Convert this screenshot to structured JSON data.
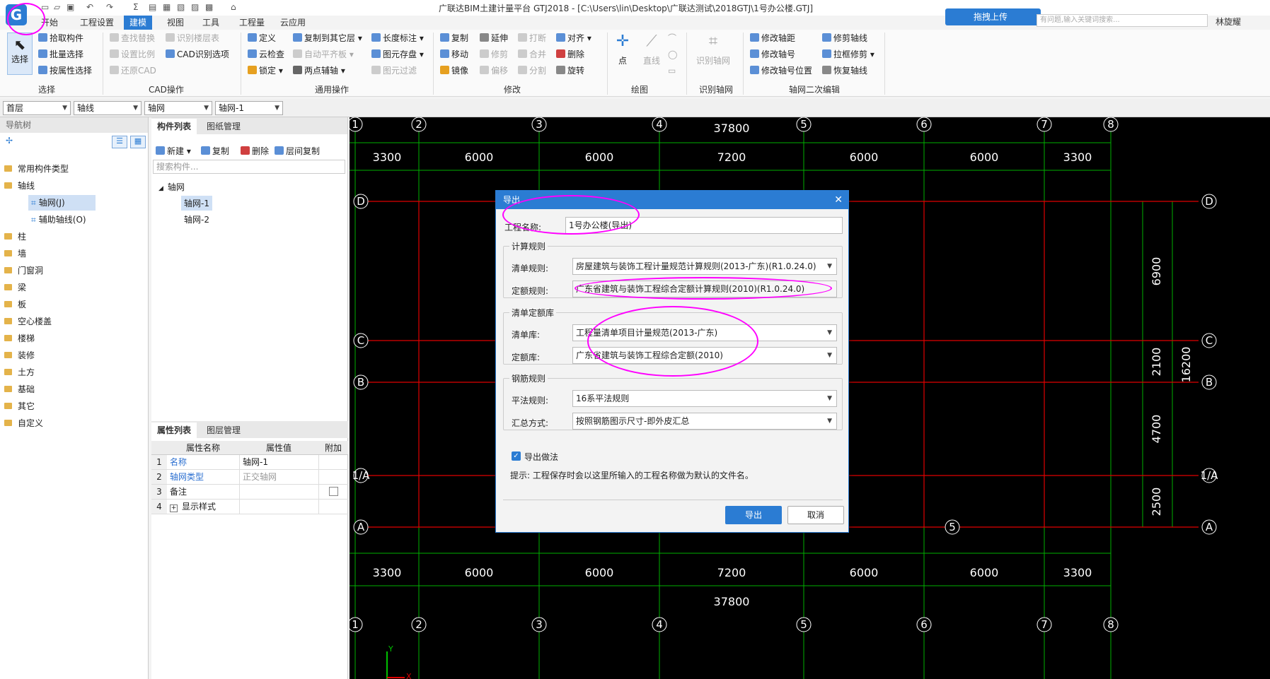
{
  "window": {
    "title": "广联达BIM土建计量平台 GTJ2018 - [C:\\Users\\lin\\Desktop\\广联达测试\\2018GTJ\\1号办公楼.GTJ]",
    "upload_label": "拖拽上传",
    "search_placeholder": "有问题,输入关键词搜索...",
    "user": "林旋耀"
  },
  "menu": [
    "开始",
    "工程设置",
    "建模",
    "视图",
    "工具",
    "工程量",
    "云应用"
  ],
  "ribbon": {
    "select_big": "选择",
    "select_items": [
      "拾取构件",
      "批量选择",
      "按属性选择"
    ],
    "cad_items": [
      "查找替换",
      "设置比例",
      "还原CAD",
      "识别楼层表",
      "CAD识别选项"
    ],
    "common_items": [
      "定义",
      "云检查",
      "锁定",
      "复制到其它层",
      "自动平齐板",
      "两点辅轴",
      "长度标注",
      "图元存盘",
      "图元过滤"
    ],
    "modify_items": [
      "复制",
      "移动",
      "镜像",
      "延伸",
      "修剪",
      "偏移",
      "打断",
      "合并",
      "分割",
      "对齐",
      "删除",
      "旋转"
    ],
    "draw_items": [
      "点",
      "直线"
    ],
    "recognize_axis": "识别轴网",
    "axis_edit_items": [
      "修改轴距",
      "修改轴号",
      "修改轴号位置",
      "修剪轴线",
      "拉框修剪",
      "恢复轴线"
    ],
    "groups": [
      "选择",
      "CAD操作",
      "通用操作",
      "修改",
      "绘图",
      "识别轴网",
      "轴网二次编辑"
    ]
  },
  "selectors": [
    "首层",
    "轴线",
    "轴网",
    "轴网-1"
  ],
  "nav": {
    "title": "导航树",
    "items": [
      "常用构件类型",
      "轴线",
      "柱",
      "墙",
      "门窗洞",
      "梁",
      "板",
      "空心楼盖",
      "楼梯",
      "装修",
      "土方",
      "基础",
      "其它",
      "自定义"
    ],
    "sub_items": [
      "轴网(J)",
      "辅助轴线(O)"
    ]
  },
  "component_list": {
    "tabs": [
      "构件列表",
      "图纸管理"
    ],
    "toolbar": [
      "新建",
      "复制",
      "删除",
      "层间复制"
    ],
    "search_placeholder": "搜索构件...",
    "root": "轴网",
    "children": [
      "轴网-1",
      "轴网-2"
    ]
  },
  "properties": {
    "tabs": [
      "属性列表",
      "图层管理"
    ],
    "headers": [
      "属性名称",
      "属性值",
      "附加"
    ],
    "rows": [
      {
        "no": "1",
        "name": "名称",
        "value": "轴网-1"
      },
      {
        "no": "2",
        "name": "轴网类型",
        "value": "正交轴网"
      },
      {
        "no": "3",
        "name": "备注",
        "value": ""
      },
      {
        "no": "4",
        "name": "显示样式",
        "value": ""
      }
    ]
  },
  "canvas": {
    "top_total": "37800",
    "bottom_total": "37800",
    "spans": [
      "3300",
      "6000",
      "6000",
      "7200",
      "6000",
      "6000",
      "3300"
    ],
    "x_axes": [
      "1",
      "2",
      "3",
      "4",
      "5",
      "6",
      "7",
      "8"
    ],
    "y_axes": [
      "D",
      "C",
      "B",
      "1/A",
      "A"
    ],
    "right_dims": [
      "6900",
      "2100",
      "4700",
      "2500"
    ],
    "right_total": "16200",
    "extra_axis_label": "5",
    "ucs_y": "Y",
    "ucs_x": "X"
  },
  "dialog": {
    "title": "导出",
    "project_name_label": "工程名称:",
    "project_name_value": "1号办公楼(导出)",
    "calc_rules_legend": "计算规则",
    "bill_rule_label": "清单规则:",
    "bill_rule_value": "房屋建筑与装饰工程计量规范计算规则(2013-广东)(R1.0.24.0)",
    "quota_rule_label": "定额规则:",
    "quota_rule_value": "广东省建筑与装饰工程综合定额计算规则(2010)(R1.0.24.0)",
    "lib_legend": "清单定额库",
    "bill_lib_label": "清单库:",
    "bill_lib_value": "工程量清单项目计量规范(2013-广东)",
    "quota_lib_label": "定额库:",
    "quota_lib_value": "广东省建筑与装饰工程综合定额(2010)",
    "rebar_legend": "钢筋规则",
    "flat_rule_label": "平法规则:",
    "flat_rule_value": "16系平法规则",
    "summary_label": "汇总方式:",
    "summary_value": "按照钢筋图示尺寸-即外皮汇总",
    "export_method_label": "导出做法",
    "hint": "提示: 工程保存时会以这里所输入的工程名称做为默认的文件名。",
    "ok": "导出",
    "cancel": "取消"
  },
  "colors": {
    "accent": "#2b7cd3",
    "annotation": "#ff00ff",
    "grid_green": "#00b000",
    "grid_red": "#e00000"
  }
}
